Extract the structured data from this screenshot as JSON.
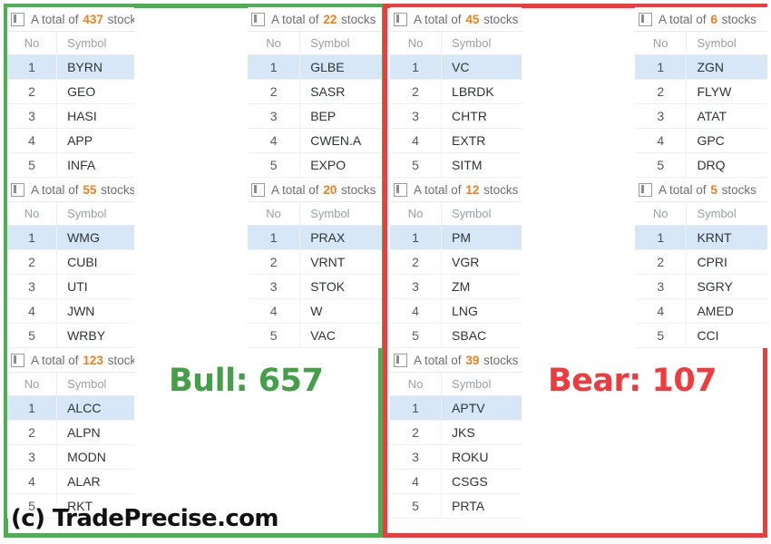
{
  "app": {
    "watermark": "(c) TradePrecise.com",
    "bull_label": "Bull: 657",
    "bear_label": "Bear: 107",
    "bull_color": "#43a047",
    "bear_color": "#ef3b3b",
    "count_color": "#f07f1a",
    "selected_row_color": "#d7e7f8"
  },
  "columns": [
    {
      "name": "bull-column-left",
      "panels": [
        {
          "header_prefix": "A total of",
          "count": "437",
          "header_suffix": "stocks",
          "icon": "panel-layout-icon",
          "columns": [
            "No",
            "Symbol"
          ],
          "rows": [
            {
              "no": "1",
              "symbol": "BYRN",
              "selected": true
            },
            {
              "no": "2",
              "symbol": "GEO",
              "selected": false
            },
            {
              "no": "3",
              "symbol": "HASI",
              "selected": false
            },
            {
              "no": "4",
              "symbol": "APP",
              "selected": false
            },
            {
              "no": "5",
              "symbol": "INFA",
              "selected": false
            }
          ]
        },
        {
          "header_prefix": "A total of",
          "count": "55",
          "header_suffix": "stocks",
          "icon": "panel-layout-icon",
          "columns": [
            "No",
            "Symbol"
          ],
          "rows": [
            {
              "no": "1",
              "symbol": "WMG",
              "selected": true
            },
            {
              "no": "2",
              "symbol": "CUBI",
              "selected": false
            },
            {
              "no": "3",
              "symbol": "UTI",
              "selected": false
            },
            {
              "no": "4",
              "symbol": "JWN",
              "selected": false
            },
            {
              "no": "5",
              "symbol": "WRBY",
              "selected": false
            }
          ]
        },
        {
          "header_prefix": "A total of",
          "count": "123",
          "header_suffix": "stocks",
          "icon": "panel-layout-icon",
          "columns": [
            "No",
            "Symbol"
          ],
          "rows": [
            {
              "no": "1",
              "symbol": "ALCC",
              "selected": true
            },
            {
              "no": "2",
              "symbol": "ALPN",
              "selected": false
            },
            {
              "no": "3",
              "symbol": "MODN",
              "selected": false
            },
            {
              "no": "4",
              "symbol": "ALAR",
              "selected": false
            },
            {
              "no": "5",
              "symbol": "RKT",
              "selected": false
            }
          ]
        }
      ]
    },
    {
      "name": "bull-column-right",
      "panels": [
        {
          "header_prefix": "A total of",
          "count": "22",
          "header_suffix": "stocks",
          "icon": "panel-layout-icon",
          "columns": [
            "No",
            "Symbol"
          ],
          "rows": [
            {
              "no": "1",
              "symbol": "GLBE",
              "selected": true
            },
            {
              "no": "2",
              "symbol": "SASR",
              "selected": false
            },
            {
              "no": "3",
              "symbol": "BEP",
              "selected": false
            },
            {
              "no": "4",
              "symbol": "CWEN.A",
              "selected": false
            },
            {
              "no": "5",
              "symbol": "EXPO",
              "selected": false
            }
          ]
        },
        {
          "header_prefix": "A total of",
          "count": "20",
          "header_suffix": "stocks",
          "icon": "panel-layout-icon",
          "columns": [
            "No",
            "Symbol"
          ],
          "rows": [
            {
              "no": "1",
              "symbol": "PRAX",
              "selected": true
            },
            {
              "no": "2",
              "symbol": "VRNT",
              "selected": false
            },
            {
              "no": "3",
              "symbol": "STOK",
              "selected": false
            },
            {
              "no": "4",
              "symbol": "W",
              "selected": false
            },
            {
              "no": "5",
              "symbol": "VAC",
              "selected": false
            }
          ]
        }
      ]
    },
    {
      "name": "bear-column-left",
      "panels": [
        {
          "header_prefix": "A total of",
          "count": "45",
          "header_suffix": "stocks",
          "icon": "panel-layout-icon",
          "columns": [
            "No",
            "Symbol"
          ],
          "rows": [
            {
              "no": "1",
              "symbol": "VC",
              "selected": true
            },
            {
              "no": "2",
              "symbol": "LBRDK",
              "selected": false
            },
            {
              "no": "3",
              "symbol": "CHTR",
              "selected": false
            },
            {
              "no": "4",
              "symbol": "EXTR",
              "selected": false
            },
            {
              "no": "5",
              "symbol": "SITM",
              "selected": false
            }
          ]
        },
        {
          "header_prefix": "A total of",
          "count": "12",
          "header_suffix": "stocks",
          "icon": "panel-layout-icon",
          "columns": [
            "No",
            "Symbol"
          ],
          "rows": [
            {
              "no": "1",
              "symbol": "PM",
              "selected": true
            },
            {
              "no": "2",
              "symbol": "VGR",
              "selected": false
            },
            {
              "no": "3",
              "symbol": "ZM",
              "selected": false
            },
            {
              "no": "4",
              "symbol": "LNG",
              "selected": false
            },
            {
              "no": "5",
              "symbol": "SBAC",
              "selected": false
            }
          ]
        },
        {
          "header_prefix": "A total of",
          "count": "39",
          "header_suffix": "stocks",
          "icon": "panel-layout-icon",
          "columns": [
            "No",
            "Symbol"
          ],
          "rows": [
            {
              "no": "1",
              "symbol": "APTV",
              "selected": true
            },
            {
              "no": "2",
              "symbol": "JKS",
              "selected": false
            },
            {
              "no": "3",
              "symbol": "ROKU",
              "selected": false
            },
            {
              "no": "4",
              "symbol": "CSGS",
              "selected": false
            },
            {
              "no": "5",
              "symbol": "PRTA",
              "selected": false
            }
          ]
        }
      ]
    },
    {
      "name": "bear-column-right",
      "panels": [
        {
          "header_prefix": "A total of",
          "count": "6",
          "header_suffix": "stocks",
          "icon": "panel-layout-icon",
          "columns": [
            "No",
            "Symbol"
          ],
          "rows": [
            {
              "no": "1",
              "symbol": "ZGN",
              "selected": true
            },
            {
              "no": "2",
              "symbol": "FLYW",
              "selected": false
            },
            {
              "no": "3",
              "symbol": "ATAT",
              "selected": false
            },
            {
              "no": "4",
              "symbol": "GPC",
              "selected": false
            },
            {
              "no": "5",
              "symbol": "DRQ",
              "selected": false
            }
          ]
        },
        {
          "header_prefix": "A total of",
          "count": "5",
          "header_suffix": "stocks",
          "icon": "panel-layout-icon",
          "columns": [
            "No",
            "Symbol"
          ],
          "rows": [
            {
              "no": "1",
              "symbol": "KRNT",
              "selected": true
            },
            {
              "no": "2",
              "symbol": "CPRI",
              "selected": false
            },
            {
              "no": "3",
              "symbol": "SGRY",
              "selected": false
            },
            {
              "no": "4",
              "symbol": "AMED",
              "selected": false
            },
            {
              "no": "5",
              "symbol": "CCI",
              "selected": false
            }
          ]
        }
      ]
    }
  ]
}
